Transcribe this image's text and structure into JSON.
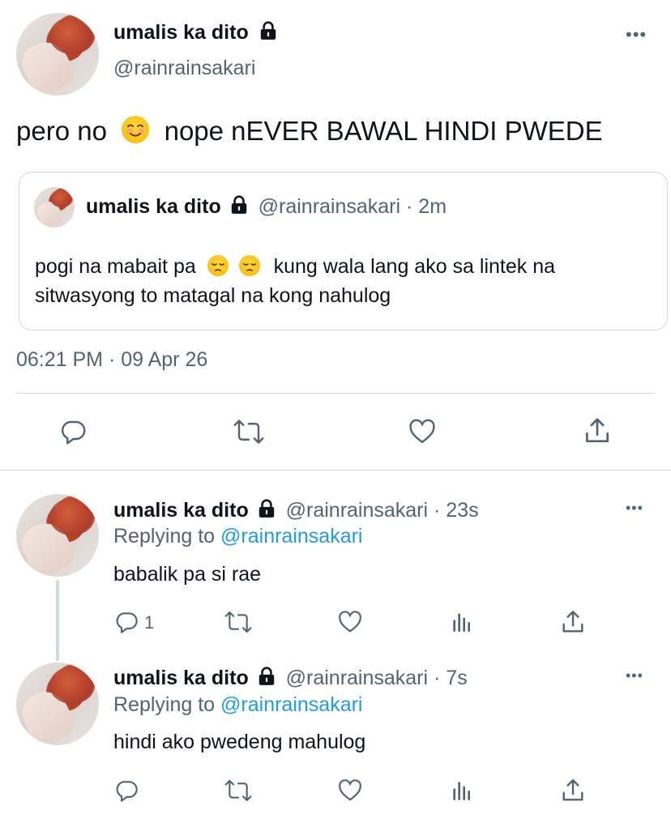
{
  "main_tweet": {
    "display_name": "umalis ka dito",
    "handle": "@rainrainsakari",
    "text_before_emoji": "pero no ",
    "emoji": "blush-smile",
    "text_after_emoji": " nope nEVER BAWAL HINDI PWEDE",
    "timestamp": "06:21 PM · 09 Apr 26"
  },
  "quoted_tweet": {
    "display_name": "umalis ka dito",
    "handle": "@rainrainsakari",
    "time": "· 2m",
    "text_before_emoji": "pogi na mabait pa ",
    "emojis": [
      "pensive",
      "pensive"
    ],
    "text_line1_after": "kung wala lang ako sa lintek na",
    "text_line2": "sitwasyong to matagal na kong nahulog"
  },
  "replies": [
    {
      "display_name": "umalis ka dito",
      "handle": "@rainrainsakari",
      "time": "· 23s",
      "replying_prefix": "Replying to ",
      "replying_handle": "@rainrainsakari",
      "text": "babalik pa si rae",
      "reply_count": "1"
    },
    {
      "display_name": "umalis ka dito",
      "handle": "@rainrainsakari",
      "time": "· 7s",
      "replying_prefix": "Replying to ",
      "replying_handle": "@rainrainsakari",
      "text": "hindi ako pwedeng mahulog",
      "reply_count": ""
    }
  ],
  "colors": {
    "text": "#0f1419",
    "secondary": "#536471",
    "link": "#1d9bf0",
    "divider": "#cfd9de"
  }
}
